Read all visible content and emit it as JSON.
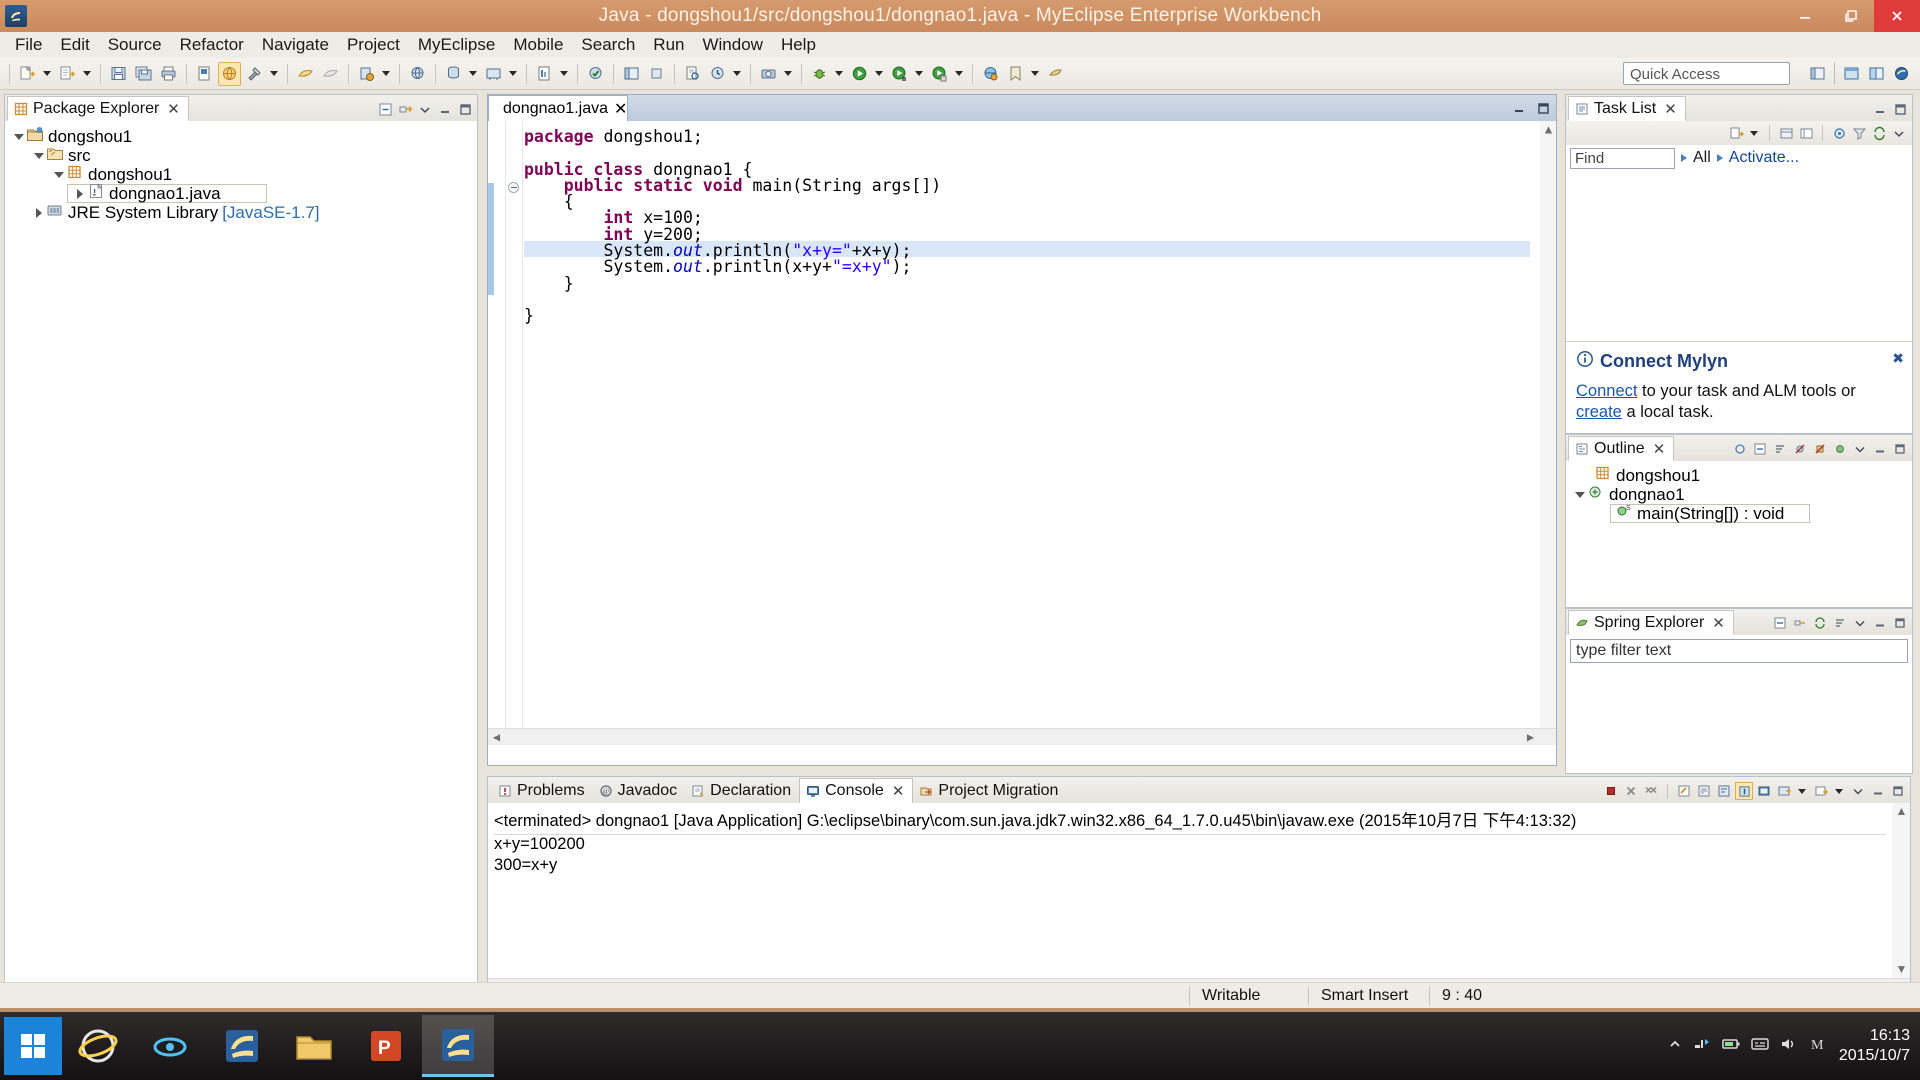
{
  "window": {
    "title": "Java - dongshou1/src/dongshou1/dongnao1.java - MyEclipse Enterprise Workbench",
    "app_icon": "eclipse-icon",
    "minimize_label": "Minimize",
    "maximize_label": "Restore",
    "close_label": "Close"
  },
  "menubar": {
    "items": [
      "File",
      "Edit",
      "Source",
      "Refactor",
      "Navigate",
      "Project",
      "MyEclipse",
      "Mobile",
      "Search",
      "Run",
      "Window",
      "Help"
    ]
  },
  "toolbar": {
    "quick_access_placeholder": "Quick Access",
    "buttons": [
      {
        "name": "new-wizard",
        "icon": "new-file-icon",
        "dropdown": true
      },
      {
        "name": "new-java-project",
        "icon": "new-project-icon",
        "dropdown": true
      },
      {
        "name": "save",
        "icon": "save-icon",
        "dropdown": false
      },
      {
        "name": "save-all",
        "icon": "save-all-icon",
        "dropdown": false
      },
      {
        "name": "print",
        "icon": "print-icon",
        "dropdown": false
      },
      {
        "name": "open-type",
        "icon": "open-type-icon",
        "dropdown": false
      },
      {
        "name": "web-browser",
        "icon": "browser-icon",
        "dropdown": false,
        "active": true
      },
      {
        "name": "build",
        "icon": "hammer-icon",
        "dropdown": true
      },
      {
        "name": "deploy",
        "icon": "deploy-icon",
        "dropdown": false
      },
      {
        "name": "undeploy",
        "icon": "undeploy-icon",
        "dropdown": false
      },
      {
        "name": "new-server",
        "icon": "server-icon",
        "dropdown": true
      },
      {
        "name": "open-browser",
        "icon": "globe-icon",
        "dropdown": false
      },
      {
        "name": "db-explorer",
        "icon": "database-icon",
        "dropdown": true
      },
      {
        "name": "new-connection",
        "icon": "connection-icon",
        "dropdown": true
      },
      {
        "name": "new-report",
        "icon": "report-icon",
        "dropdown": false
      },
      {
        "name": "validation",
        "icon": "validate-icon",
        "dropdown": true
      },
      {
        "name": "open-perspective",
        "icon": "perspective-icon",
        "dropdown": false
      },
      {
        "name": "search",
        "icon": "search-icon",
        "dropdown": false
      },
      {
        "name": "external-tools",
        "icon": "external-tools-icon",
        "dropdown": false
      },
      {
        "name": "run-history",
        "icon": "run-history-icon",
        "dropdown": true
      },
      {
        "name": "snapshot",
        "icon": "snapshot-icon",
        "dropdown": true
      },
      {
        "name": "debug",
        "icon": "debug-icon",
        "dropdown": true
      },
      {
        "name": "run",
        "icon": "run-icon",
        "dropdown": true
      },
      {
        "name": "run-config",
        "icon": "run-config-icon",
        "dropdown": true
      },
      {
        "name": "coverage",
        "icon": "coverage-icon",
        "dropdown": true
      },
      {
        "name": "profile",
        "icon": "profile-icon",
        "dropdown": false
      },
      {
        "name": "open-task",
        "icon": "task-icon",
        "dropdown": false
      },
      {
        "name": "bookmark",
        "icon": "bookmark-icon",
        "dropdown": true
      },
      {
        "name": "mylyn-context",
        "icon": "context-icon",
        "dropdown": false
      }
    ]
  },
  "package_explorer": {
    "title": "Package Explorer",
    "tools": [
      "collapse-all-icon",
      "link-editor-icon",
      "view-menu-icon",
      "minimize-icon",
      "maximize-icon"
    ],
    "tree": [
      {
        "label": "dongshou1",
        "icon": "java-project-icon",
        "depth": 0,
        "state": "open"
      },
      {
        "label": "src",
        "icon": "source-folder-icon",
        "depth": 1,
        "state": "open"
      },
      {
        "label": "dongshou1",
        "icon": "package-icon",
        "depth": 2,
        "state": "open"
      },
      {
        "label": "dongnao1.java",
        "icon": "java-file-icon",
        "depth": 3,
        "state": "closed",
        "selected": true
      },
      {
        "label": "JRE System Library",
        "sub": "[JavaSE-1.7]",
        "icon": "library-icon",
        "depth": 1,
        "state": "closed"
      }
    ]
  },
  "editor": {
    "tab_label": "dongnao1.java",
    "tab_icon": "java-file-icon",
    "close_label": "×",
    "cursor_line_index": 7,
    "lines": [
      [
        {
          "t": "package ",
          "c": "kw"
        },
        {
          "t": "dongshou1;",
          "c": ""
        }
      ],
      [],
      [
        {
          "t": "public class ",
          "c": "kw"
        },
        {
          "t": "dongnao1 {",
          "c": ""
        }
      ],
      [
        {
          "t": "    public static void ",
          "c": "kw"
        },
        {
          "t": "main(String args[])",
          "c": ""
        }
      ],
      [
        {
          "t": "    {",
          "c": ""
        }
      ],
      [
        {
          "t": "        ",
          "c": ""
        },
        {
          "t": "int ",
          "c": "kw"
        },
        {
          "t": "x=100;",
          "c": ""
        }
      ],
      [
        {
          "t": "        ",
          "c": ""
        },
        {
          "t": "int ",
          "c": "kw"
        },
        {
          "t": "y=200;",
          "c": ""
        }
      ],
      [
        {
          "t": "        System.",
          "c": ""
        },
        {
          "t": "out",
          "c": "fld"
        },
        {
          "t": ".println(",
          "c": ""
        },
        {
          "t": "\"x+y=\"",
          "c": "str"
        },
        {
          "t": "+x+y);",
          "c": ""
        }
      ],
      [
        {
          "t": "        System.",
          "c": ""
        },
        {
          "t": "out",
          "c": "fld"
        },
        {
          "t": ".println(x+y+",
          "c": ""
        },
        {
          "t": "\"=x+y\"",
          "c": "str"
        },
        {
          "t": ");",
          "c": ""
        }
      ],
      [
        {
          "t": "    }",
          "c": ""
        }
      ],
      [],
      [
        {
          "t": "}",
          "c": ""
        }
      ]
    ]
  },
  "task_list": {
    "title": "Task List",
    "find_placeholder": "Find",
    "all_label": "All",
    "activate_label": "Activate...",
    "tools": [
      "new-task-icon",
      "categorize-icon",
      "presentation-icon",
      "focus-icon",
      "filter-icon",
      "synchronize-icon",
      "view-menu-icon",
      "minimize-icon",
      "maximize-icon"
    ]
  },
  "mylyn": {
    "title": "Connect Mylyn",
    "connect_link": "Connect",
    "text_mid": " to your task and ALM tools or ",
    "create_link": "create",
    "text_end": " a local task.",
    "close_label": "⌧"
  },
  "outline": {
    "title": "Outline",
    "tools": [
      "focus-icon",
      "collapse-all-icon",
      "sort-icon",
      "hide-fields-icon",
      "hide-static-icon",
      "hide-nonpublic-icon",
      "view-menu-icon",
      "minimize-icon",
      "maximize-icon"
    ],
    "items": [
      {
        "label": "dongshou1",
        "icon": "package-icon",
        "depth": 0,
        "state": "none"
      },
      {
        "label": "dongnao1",
        "icon": "class-icon",
        "depth": 0,
        "state": "open"
      },
      {
        "label": "main(String[]) : void",
        "icon": "method-static-icon",
        "depth": 1,
        "state": "none"
      }
    ]
  },
  "spring_explorer": {
    "title": "Spring Explorer",
    "filter_value": "type filter text",
    "tools": [
      "collapse-all-icon",
      "link-icon",
      "refresh-icon",
      "sort-icon",
      "view-menu-icon",
      "minimize-icon",
      "maximize-icon"
    ]
  },
  "bottom_panel": {
    "tabs": [
      {
        "label": "Problems",
        "icon": "problems-icon",
        "selected": false,
        "closable": false
      },
      {
        "label": "Javadoc",
        "icon": "javadoc-icon",
        "selected": false,
        "closable": false
      },
      {
        "label": "Declaration",
        "icon": "declaration-icon",
        "selected": false,
        "closable": false
      },
      {
        "label": "Console",
        "icon": "console-icon",
        "selected": true,
        "closable": true
      },
      {
        "label": "Project Migration",
        "icon": "migration-icon",
        "selected": false,
        "closable": false
      }
    ],
    "tools": [
      "terminate-icon",
      "remove-launch-icon",
      "remove-all-icon",
      "clear-console-icon",
      "scroll-lock-icon",
      "word-wrap-icon",
      "pin-console-icon",
      "display-console-icon",
      "open-console-icon",
      "new-console-view-icon",
      "view-menu-icon",
      "minimize-icon",
      "maximize-icon"
    ],
    "console": {
      "header": "<terminated> dongnao1 [Java Application] G:\\eclipse\\binary\\com.sun.java.jdk7.win32.x86_64_1.7.0.u45\\bin\\javaw.exe (2015年10月7日 下午4:13:32)",
      "output": [
        "x+y=100200",
        "300=x+y"
      ]
    }
  },
  "statusbar": {
    "writable": "Writable",
    "insert_mode": "Smart Insert",
    "position": "9 : 40"
  },
  "taskbar": {
    "start_label": "Start",
    "apps": [
      {
        "name": "internet-explorer",
        "icon": "ie-icon"
      },
      {
        "name": "media-app",
        "icon": "media-icon"
      },
      {
        "name": "eclipse-launcher",
        "icon": "eclipse-icon"
      },
      {
        "name": "file-explorer",
        "icon": "folder-icon"
      },
      {
        "name": "powerpoint",
        "icon": "powerpoint-icon"
      },
      {
        "name": "myeclipse-running",
        "icon": "eclipse-icon",
        "active": true
      }
    ],
    "tray_icons": [
      "show-hidden-icon",
      "network-icon",
      "battery-icon",
      "input-method-icon",
      "volume-icon",
      "security-icon"
    ],
    "clock_time": "16:13",
    "clock_date": "2015/10/7"
  },
  "colors": {
    "title_bar": "#cf9264",
    "accent_blue": "#4a7fb5",
    "selection": "#d8e6f7",
    "keyword": "#7f0055",
    "string": "#2a00ff",
    "field": "#0000c0",
    "taskbar": "#1b1b20"
  }
}
